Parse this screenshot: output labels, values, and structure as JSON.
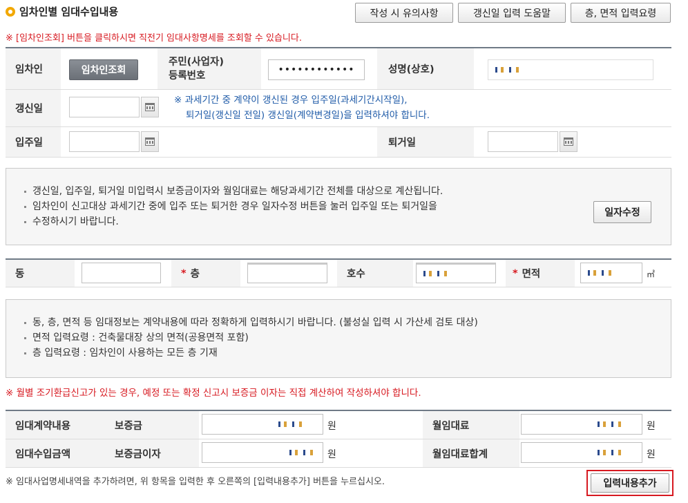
{
  "header": {
    "title": "임차인별 임대수입내용",
    "buttons": [
      "작성 시 유의사항",
      "갱신일 입력 도움말",
      "층, 면적 입력요령"
    ]
  },
  "notes": {
    "lookup": "※ [임차인조회] 버튼을 클릭하시면 직전기 임대사항명세를 조회할 수 있습니다.",
    "renewal_line1": "※ 과세기간 중 계약이 갱신된 경우 입주일(과세기간시작일),",
    "renewal_line2": "퇴거일(갱신일 전일) 갱신일(계약변경일)을 입력하셔야 합니다.",
    "refund": "※ 월별 조기환급신고가 있는 경우, 예정 또는 확정 신고시 보증금 이자는 직접 계산하여 작성하셔야 합니다.",
    "bottom": "※ 임대사업명세내역을 추가하려면, 위 항목을 입력한 후 오른쪽의 [입력내용추가] 버튼을 누르십시오."
  },
  "tenant": {
    "label": "임차인",
    "lookup_button": "임차인조회",
    "id_label_line1": "주민(사업자)",
    "id_label_line2": "등록번호",
    "id_value": "••••••••••••",
    "name_label": "성명(상호)"
  },
  "dates": {
    "renewal_label": "갱신일",
    "movein_label": "입주일",
    "moveout_label": "퇴거일"
  },
  "info1": {
    "items": [
      "갱신일, 입주일, 퇴거일 미입력시 보증금이자와 월임대료는 해당과세기간 전체를 대상으로 계산됩니다.",
      "임차인이 신고대상 과세기간 중에 입주 또는 퇴거한 경우 일자수정 버튼을 눌러 입주일 또는 퇴거일을",
      "수정하시기 바랍니다."
    ],
    "date_fix_button": "일자수정"
  },
  "unit_row": {
    "dong_label": "동",
    "floor_star": "*",
    "floor_label": "층",
    "ho_label": "호수",
    "area_star": "*",
    "area_label": "면적",
    "area_unit": "㎡"
  },
  "info2": {
    "items": [
      "동, 층, 면적 등 임대정보는 계약내용에 따라 정확하게 입력하시기 바랍니다. (불성실 입력 시 가산세 검토 대상)",
      "면적 입력요령 : 건축물대장 상의 면적(공용면적 포함)",
      "층 입력요령 : 임차인이 사용하는 모든 층 기재"
    ]
  },
  "money": {
    "contract_label": "임대계약내용",
    "deposit_label": "보증금",
    "monthly_rent_label": "월임대료",
    "income_label": "임대수입금액",
    "deposit_interest_label": "보증금이자",
    "rent_total_label": "월임대료합계",
    "won": "원"
  },
  "actions": {
    "add_button": "입력내용추가"
  }
}
